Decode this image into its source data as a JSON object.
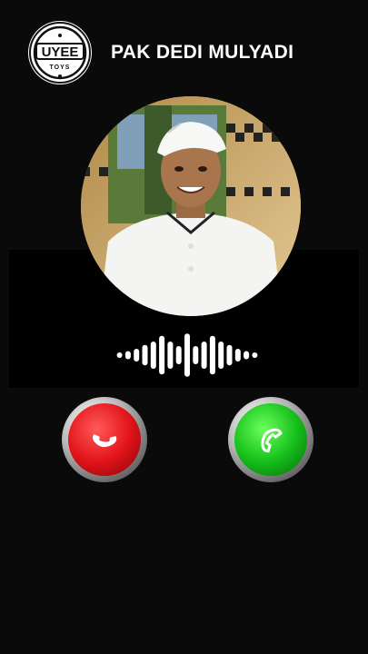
{
  "logo": {
    "brand": "UYEE",
    "sub": "TOYS"
  },
  "caller": {
    "name": "PAK DEDI MULYADI",
    "photo_icon": "caller-photo"
  },
  "waveform": {
    "levels": [
      0.12,
      0.18,
      0.28,
      0.45,
      0.6,
      0.85,
      0.6,
      0.4,
      0.95,
      0.4,
      0.6,
      0.85,
      0.6,
      0.45,
      0.28,
      0.18,
      0.12
    ]
  },
  "buttons": {
    "decline": {
      "icon": "phone-hangup-icon",
      "color": "#e8151b"
    },
    "accept": {
      "icon": "phone-answer-icon",
      "color": "#19c21d"
    }
  },
  "colors": {
    "background": "#0a0a0a",
    "text": "#ffffff"
  }
}
